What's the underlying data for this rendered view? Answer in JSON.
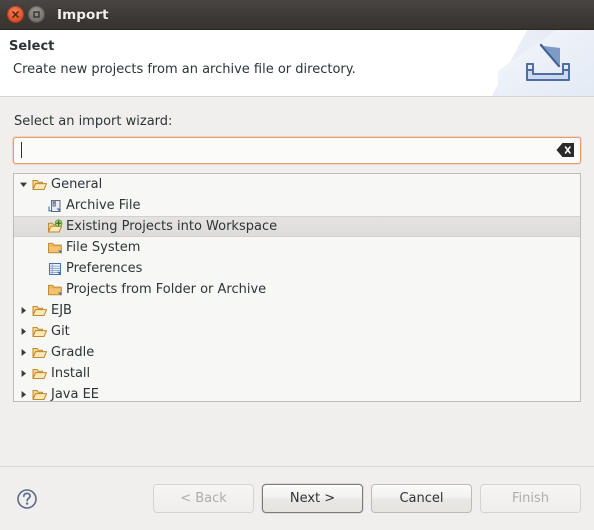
{
  "window": {
    "title": "Import",
    "close_icon": "close-icon",
    "maximize_icon": "maximize-icon"
  },
  "header": {
    "title": "Select",
    "description": "Create new projects from an archive file or directory.",
    "icon": "import-wizard-icon"
  },
  "form": {
    "label": "Select an import wizard:",
    "search_value": "",
    "search_placeholder": "",
    "clear_icon": "clear-icon"
  },
  "tree": {
    "items": [
      {
        "label": "General",
        "level": 0,
        "expanded": true,
        "has_children": true,
        "icon": "folder-open-icon",
        "selected": false
      },
      {
        "label": "Archive File",
        "level": 1,
        "expanded": false,
        "has_children": false,
        "icon": "archive-file-icon",
        "selected": false
      },
      {
        "label": "Existing Projects into Workspace",
        "level": 1,
        "expanded": false,
        "has_children": false,
        "icon": "import-projects-icon",
        "selected": true
      },
      {
        "label": "File System",
        "level": 1,
        "expanded": false,
        "has_children": false,
        "icon": "file-system-folder-icon",
        "selected": false
      },
      {
        "label": "Preferences",
        "level": 1,
        "expanded": false,
        "has_children": false,
        "icon": "preferences-icon",
        "selected": false
      },
      {
        "label": "Projects from Folder or Archive",
        "level": 1,
        "expanded": false,
        "has_children": false,
        "icon": "file-system-folder-icon",
        "selected": false
      },
      {
        "label": "EJB",
        "level": 0,
        "expanded": false,
        "has_children": true,
        "icon": "folder-open-icon",
        "selected": false
      },
      {
        "label": "Git",
        "level": 0,
        "expanded": false,
        "has_children": true,
        "icon": "folder-open-icon",
        "selected": false
      },
      {
        "label": "Gradle",
        "level": 0,
        "expanded": false,
        "has_children": true,
        "icon": "folder-open-icon",
        "selected": false
      },
      {
        "label": "Install",
        "level": 0,
        "expanded": false,
        "has_children": true,
        "icon": "folder-open-icon",
        "selected": false
      },
      {
        "label": "Java EE",
        "level": 0,
        "expanded": false,
        "has_children": true,
        "icon": "folder-open-icon",
        "selected": false
      }
    ]
  },
  "footer": {
    "help_icon": "help-icon",
    "buttons": [
      {
        "label": "< Back",
        "enabled": false,
        "default": false
      },
      {
        "label": "Next >",
        "enabled": true,
        "default": true
      },
      {
        "label": "Cancel",
        "enabled": true,
        "default": false
      },
      {
        "label": "Finish",
        "enabled": false,
        "default": false
      }
    ]
  },
  "colors": {
    "titlebar": "#3d3936",
    "close_button": "#e2552a",
    "focus_border": "#e79a6e",
    "selection": "#e0dedc",
    "text": "#2e3436",
    "folder": "#f0b860"
  }
}
